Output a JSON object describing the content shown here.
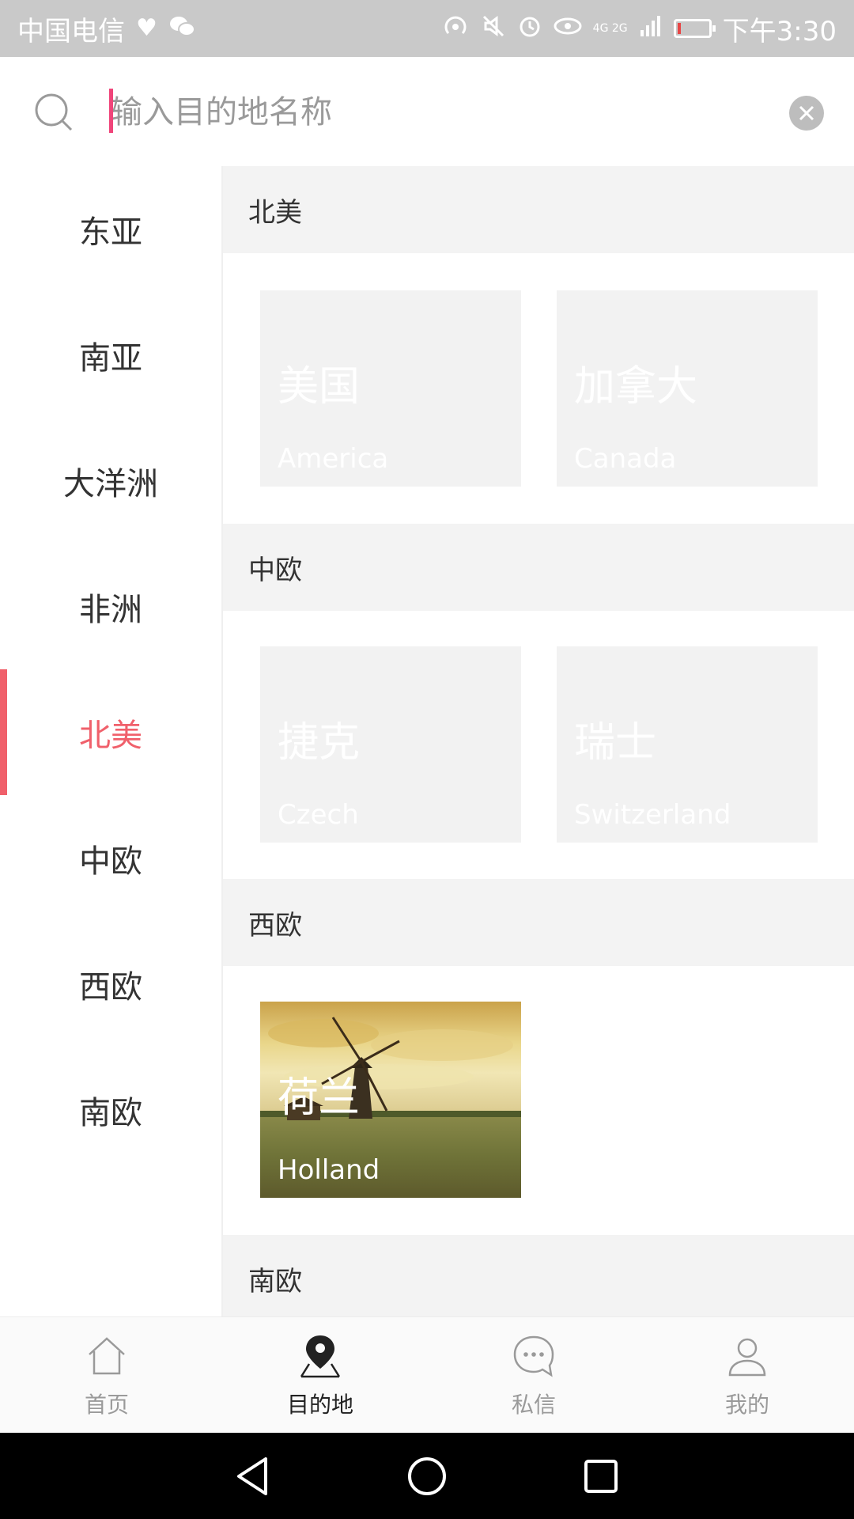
{
  "status_bar": {
    "carrier": "中国电信",
    "time": "下午3:30",
    "network": "4G 2G"
  },
  "search": {
    "placeholder": "输入目的地名称"
  },
  "sidebar": {
    "items": [
      {
        "label": "东亚"
      },
      {
        "label": "南亚"
      },
      {
        "label": "大洋洲"
      },
      {
        "label": "非洲"
      },
      {
        "label": "北美"
      },
      {
        "label": "中欧"
      },
      {
        "label": "西欧"
      },
      {
        "label": "南欧"
      }
    ],
    "active_index": 4
  },
  "sections": [
    {
      "title": "北美",
      "cards": [
        {
          "zh": "美国",
          "en": "America"
        },
        {
          "zh": "加拿大",
          "en": "Canada"
        }
      ]
    },
    {
      "title": "中欧",
      "cards": [
        {
          "zh": "捷克",
          "en": "Czech"
        },
        {
          "zh": "瑞士",
          "en": "Switzerland"
        }
      ]
    },
    {
      "title": "西欧",
      "cards": [
        {
          "zh": "荷兰",
          "en": "Holland"
        }
      ]
    },
    {
      "title": "南欧",
      "cards": []
    }
  ],
  "bottom_nav": {
    "items": [
      {
        "label": "首页",
        "icon": "home-icon"
      },
      {
        "label": "目的地",
        "icon": "location-pin-icon"
      },
      {
        "label": "私信",
        "icon": "chat-bubble-icon"
      },
      {
        "label": "我的",
        "icon": "person-icon"
      }
    ],
    "active_index": 1
  },
  "colors": {
    "accent": "#f0606b",
    "caret": "#f0457a",
    "section_bg": "#f3f3f3"
  }
}
